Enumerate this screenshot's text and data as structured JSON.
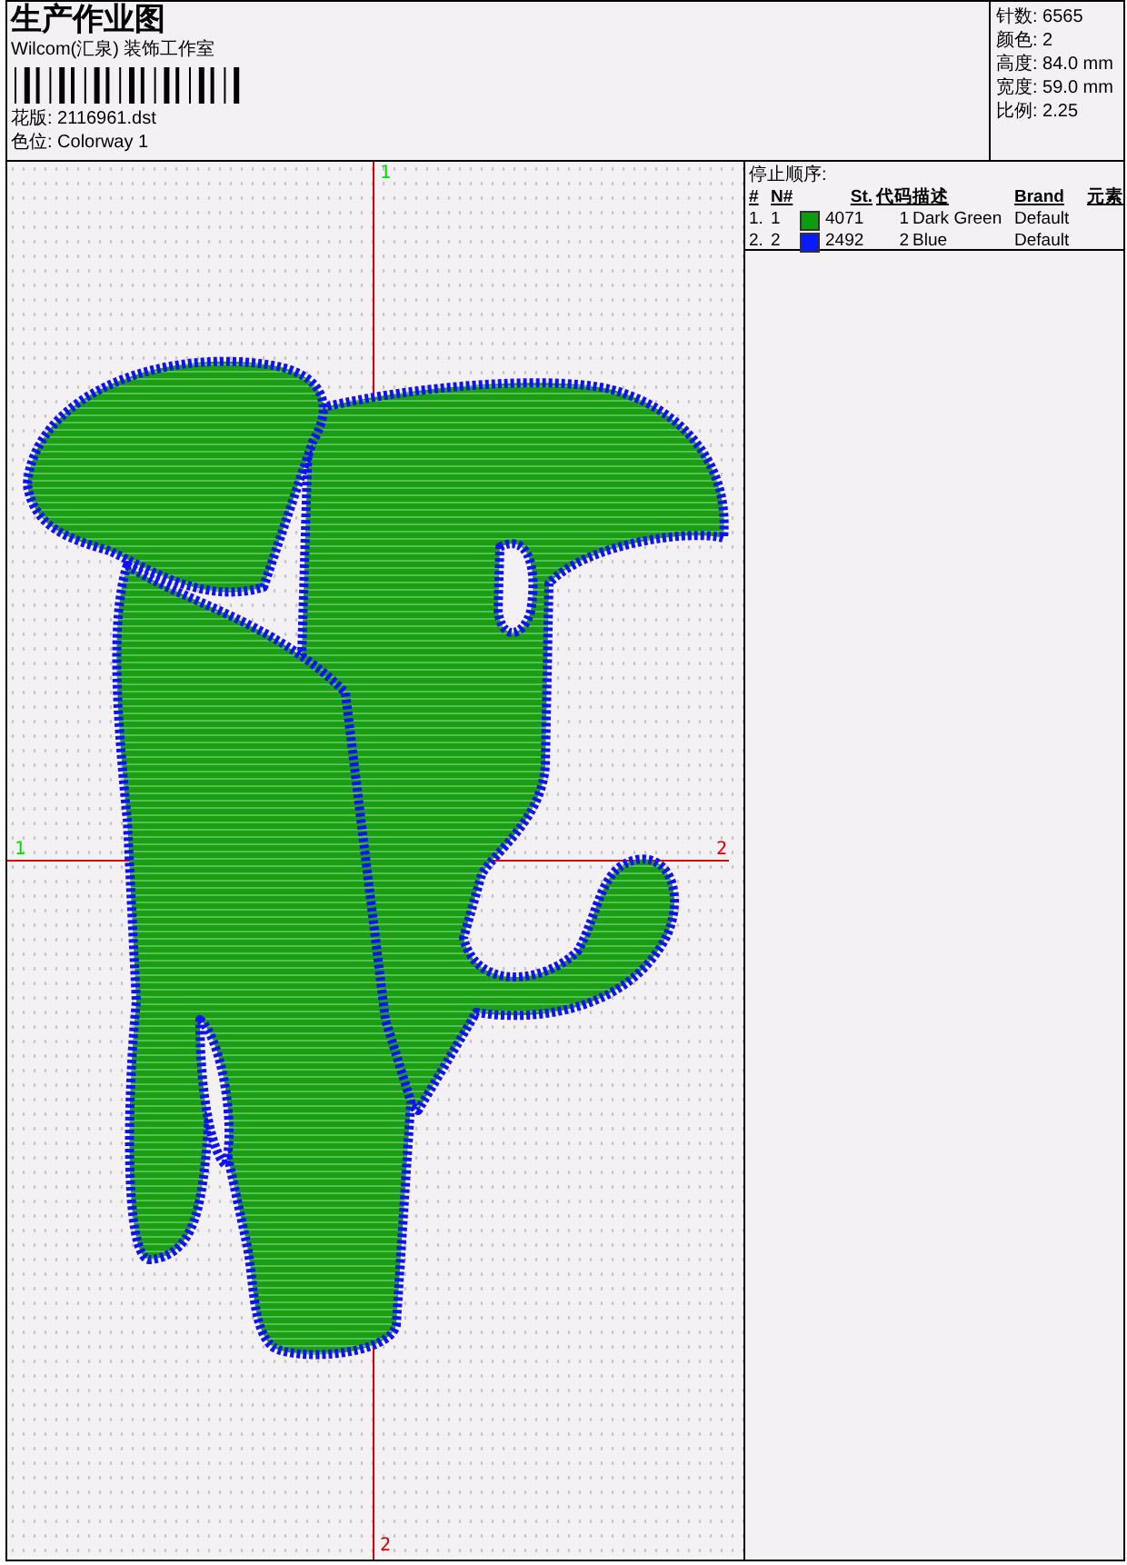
{
  "document": {
    "title": "生产作业图",
    "studio": "Wilcom(汇泉) 装饰工作室",
    "design": "花版: 2116961.dst",
    "colorway": "色位: Colorway 1"
  },
  "summary": [
    "针数: 6565",
    "颜色: 2",
    "高度: 84.0 mm",
    "宽度: 59.0 mm",
    "比例: 2.25"
  ],
  "canvas": {
    "axis_labels": [
      {
        "text": "1",
        "kind": "top"
      },
      {
        "text": "1",
        "kind": "left"
      },
      {
        "text": "2",
        "kind": "right"
      },
      {
        "text": "2",
        "kind": "bottom"
      }
    ]
  },
  "stop_sequence": {
    "title": "停止顺序:",
    "columns": [
      "#",
      "N#",
      "St.",
      "代码",
      "描述",
      "Brand",
      "元素"
    ],
    "rows": [
      {
        "index": "1.",
        "number": "1",
        "color": "#109a10",
        "stitches": "4071",
        "code": "1",
        "description": "Dark Green",
        "brand": "Default"
      },
      {
        "index": "2.",
        "number": "2",
        "color": "#0a1aff",
        "stitches": "2492",
        "code": "2",
        "description": "Blue",
        "brand": "Default"
      }
    ]
  }
}
